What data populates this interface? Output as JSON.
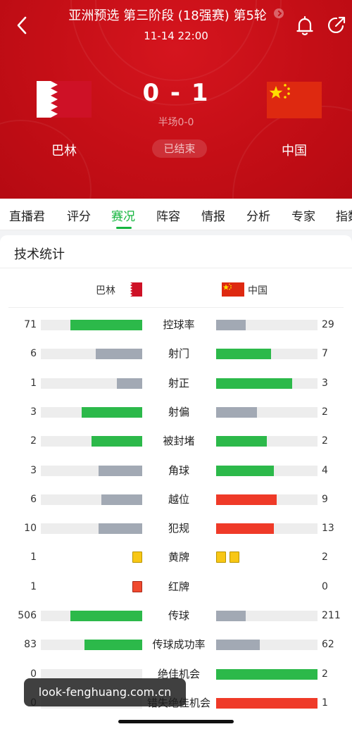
{
  "header": {
    "round_title": "亚洲预选 第三阶段 (18强赛) 第5轮",
    "match_time": "11-14 22:00",
    "score": "0 - 1",
    "halftime": "半场0-0",
    "status": "已结束",
    "home_team": "巴林",
    "away_team": "中国",
    "icons": [
      "back-icon",
      "chevron-right-icon",
      "bell-icon",
      "share-icon",
      "bahrain-flag-icon",
      "china-flag-icon"
    ]
  },
  "tabs": [
    {
      "label": "直播君",
      "active": false
    },
    {
      "label": "评分",
      "active": false
    },
    {
      "label": "赛况",
      "active": true
    },
    {
      "label": "阵容",
      "active": false
    },
    {
      "label": "情报",
      "active": false
    },
    {
      "label": "分析",
      "active": false
    },
    {
      "label": "专家",
      "active": false
    },
    {
      "label": "指数",
      "active": false
    }
  ],
  "stats": {
    "title": "技术统计",
    "home_name": "巴林",
    "away_name": "中国",
    "colors": {
      "green": "#2cb94a",
      "gray": "#a2a9b4",
      "red": "#ef3a28",
      "yellow": "#f8c715",
      "red_card": "#f04a2f",
      "track": "#ededed",
      "accent": "#14b53e"
    },
    "rows": [
      {
        "label": "控球率",
        "home": "71",
        "away": "29",
        "home_frac": 0.71,
        "away_frac": 0.29,
        "home_color": "green",
        "away_color": "gray"
      },
      {
        "label": "射门",
        "home": "6",
        "away": "7",
        "home_frac": 0.46,
        "away_frac": 0.54,
        "home_color": "gray",
        "away_color": "green"
      },
      {
        "label": "射正",
        "home": "1",
        "away": "3",
        "home_frac": 0.25,
        "away_frac": 0.75,
        "home_color": "gray",
        "away_color": "green"
      },
      {
        "label": "射偏",
        "home": "3",
        "away": "2",
        "home_frac": 0.6,
        "away_frac": 0.4,
        "home_color": "green",
        "away_color": "gray"
      },
      {
        "label": "被封堵",
        "home": "2",
        "away": "2",
        "home_frac": 0.5,
        "away_frac": 0.5,
        "home_color": "green",
        "away_color": "green"
      },
      {
        "label": "角球",
        "home": "3",
        "away": "4",
        "home_frac": 0.43,
        "away_frac": 0.57,
        "home_color": "gray",
        "away_color": "green"
      },
      {
        "label": "越位",
        "home": "6",
        "away": "9",
        "home_frac": 0.4,
        "away_frac": 0.6,
        "home_color": "gray",
        "away_color": "red"
      },
      {
        "label": "犯规",
        "home": "10",
        "away": "13",
        "home_frac": 0.43,
        "away_frac": 0.57,
        "home_color": "gray",
        "away_color": "red"
      },
      {
        "label": "黄牌",
        "home": "1",
        "away": "2",
        "type": "yellow"
      },
      {
        "label": "红牌",
        "home": "1",
        "away": "0",
        "type": "red"
      },
      {
        "label": "传球",
        "home": "506",
        "away": "211",
        "home_frac": 0.71,
        "away_frac": 0.29,
        "home_color": "green",
        "away_color": "gray"
      },
      {
        "label": "传球成功率",
        "home": "83",
        "away": "62",
        "home_frac": 0.57,
        "away_frac": 0.43,
        "home_color": "green",
        "away_color": "gray"
      },
      {
        "label": "绝佳机会",
        "home": "0",
        "away": "2",
        "home_frac": 0,
        "away_frac": 1,
        "home_color": "green",
        "away_color": "green"
      },
      {
        "label": "错失绝佳机会",
        "home": "0",
        "away": "1",
        "home_frac": 0,
        "away_frac": 1,
        "home_color": "red",
        "away_color": "red"
      }
    ]
  },
  "watermark": "look-fenghuang.com.cn"
}
